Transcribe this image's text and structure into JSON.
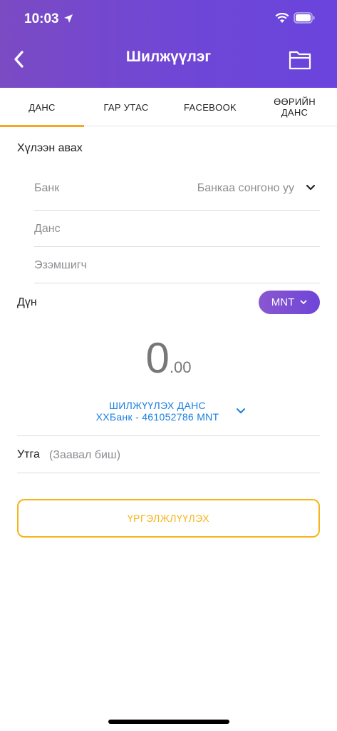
{
  "status_bar": {
    "time": "10:03"
  },
  "header": {
    "title": "Шилжүүлэг"
  },
  "tabs": [
    {
      "label": "ДАНС",
      "active": true
    },
    {
      "label": "ГАР УТАС",
      "active": false
    },
    {
      "label": "FACEBOOK",
      "active": false
    },
    {
      "label_line1": "ӨӨРИЙН",
      "label_line2": "ДАНС",
      "active": false
    }
  ],
  "receiver": {
    "section_label": "Хүлээн авах",
    "bank_label": "Банк",
    "bank_placeholder": "Банкаа сонгоно уу",
    "account_placeholder": "Данс",
    "owner_placeholder": "Эзэмшигч"
  },
  "amount": {
    "label": "Дүн",
    "currency": "MNT",
    "integer_part": "0",
    "decimal_part": ".00"
  },
  "source_account": {
    "title": "ШИЛЖҮҮЛЭХ ДАНС",
    "detail": "XXБанк - 461052786 MNT"
  },
  "note": {
    "label": "Утга",
    "placeholder": "(Заавал биш)"
  },
  "continue_button": {
    "label": "ҮРГЭЛЖЛҮҮЛЭХ"
  },
  "colors": {
    "header_gradient_start": "#7b4bc4",
    "header_gradient_end": "#6a44dd",
    "accent_orange": "#f5a623",
    "button_yellow": "#f5b41a",
    "link_blue": "#1a7fe0"
  },
  "icons": {
    "back": "chevron-left-icon",
    "folder": "folder-icon",
    "dropdown": "chevron-down-icon"
  }
}
